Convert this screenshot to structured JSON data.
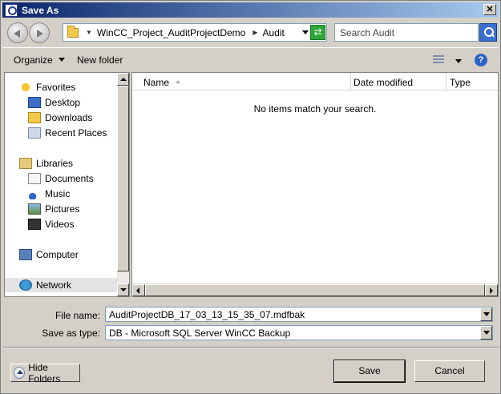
{
  "window": {
    "title": "Save As"
  },
  "address": {
    "crumbs": [
      "WinCC_Project_AuditProjectDemo",
      "Audit"
    ]
  },
  "search": {
    "placeholder": "Search Audit"
  },
  "toolbar": {
    "organize": "Organize",
    "new_folder": "New folder"
  },
  "nav": {
    "items": [
      {
        "label": "Favorites",
        "icon": "star-icon"
      },
      {
        "label": "Desktop",
        "icon": "desktop-icon"
      },
      {
        "label": "Downloads",
        "icon": "downloads-folder-icon"
      },
      {
        "label": "Recent Places",
        "icon": "recent-places-icon"
      },
      {
        "label": "Libraries",
        "icon": "libraries-icon"
      },
      {
        "label": "Documents",
        "icon": "documents-icon"
      },
      {
        "label": "Music",
        "icon": "music-icon"
      },
      {
        "label": "Pictures",
        "icon": "pictures-icon"
      },
      {
        "label": "Videos",
        "icon": "videos-icon"
      },
      {
        "label": "Computer",
        "icon": "computer-icon"
      },
      {
        "label": "Network",
        "icon": "network-icon"
      }
    ]
  },
  "filelist": {
    "columns": [
      "Name",
      "Date modified",
      "Type"
    ],
    "empty_message": "No items match your search."
  },
  "form": {
    "filename_label": "File name:",
    "filename_value": "AuditProjectDB_17_03_13_15_35_07.mdfbak",
    "savetype_label": "Save as type:",
    "savetype_value": "DB - Microsoft SQL Server WinCC Backup"
  },
  "buttons": {
    "hide_folders": "Hide Folders",
    "save": "Save",
    "cancel": "Cancel"
  },
  "icons": {
    "help": "?",
    "close": "✕",
    "refresh": "⇄"
  }
}
